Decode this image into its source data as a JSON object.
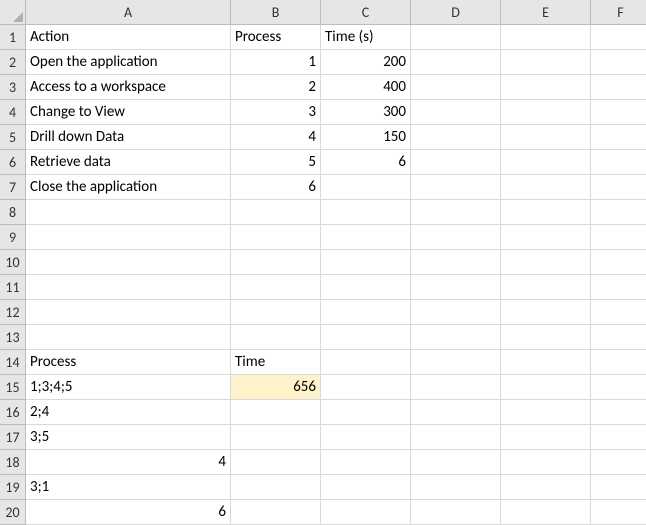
{
  "columns": [
    "A",
    "B",
    "C",
    "D",
    "E",
    "F"
  ],
  "row_count": 20,
  "cells": {
    "A1": {
      "v": "Action",
      "t": "txt"
    },
    "B1": {
      "v": "Process",
      "t": "txt"
    },
    "C1": {
      "v": "Time (s)",
      "t": "txt"
    },
    "A2": {
      "v": "Open the application",
      "t": "txt"
    },
    "B2": {
      "v": "1",
      "t": "num"
    },
    "C2": {
      "v": "200",
      "t": "num"
    },
    "A3": {
      "v": "Access to a workspace",
      "t": "txt"
    },
    "B3": {
      "v": "2",
      "t": "num"
    },
    "C3": {
      "v": "400",
      "t": "num"
    },
    "A4": {
      "v": "Change to View",
      "t": "txt"
    },
    "B4": {
      "v": "3",
      "t": "num"
    },
    "C4": {
      "v": "300",
      "t": "num"
    },
    "A5": {
      "v": "Drill down Data",
      "t": "txt"
    },
    "B5": {
      "v": "4",
      "t": "num"
    },
    "C5": {
      "v": "150",
      "t": "num"
    },
    "A6": {
      "v": "Retrieve data",
      "t": "txt"
    },
    "B6": {
      "v": "5",
      "t": "num"
    },
    "C6": {
      "v": "6",
      "t": "num"
    },
    "A7": {
      "v": "Close the application",
      "t": "txt"
    },
    "B7": {
      "v": "6",
      "t": "num"
    },
    "A14": {
      "v": "Process",
      "t": "txt"
    },
    "B14": {
      "v": "Time",
      "t": "txt"
    },
    "A15": {
      "v": "1;3;4;5",
      "t": "txt"
    },
    "B15": {
      "v": "656",
      "t": "num",
      "hl": true
    },
    "A16": {
      "v": "2;4",
      "t": "txt"
    },
    "A17": {
      "v": "3;5",
      "t": "txt"
    },
    "A18": {
      "v": "4",
      "t": "num"
    },
    "A19": {
      "v": "3;1",
      "t": "txt"
    },
    "A20": {
      "v": "6",
      "t": "num"
    }
  },
  "chart_data": {
    "type": "table",
    "tables": [
      {
        "title": "Process timings",
        "columns": [
          "Action",
          "Process",
          "Time (s)"
        ],
        "rows": [
          [
            "Open the application",
            1,
            200
          ],
          [
            "Access to a workspace",
            2,
            400
          ],
          [
            "Change to View",
            3,
            300
          ],
          [
            "Drill down Data",
            4,
            150
          ],
          [
            "Retrieve data",
            5,
            6
          ],
          [
            "Close the application",
            6,
            null
          ]
        ]
      },
      {
        "title": "Process combinations",
        "columns": [
          "Process",
          "Time"
        ],
        "rows": [
          [
            "1;3;4;5",
            656
          ],
          [
            "2;4",
            null
          ],
          [
            "3;5",
            null
          ],
          [
            4,
            null
          ],
          [
            "3;1",
            null
          ],
          [
            6,
            null
          ]
        ]
      }
    ]
  }
}
